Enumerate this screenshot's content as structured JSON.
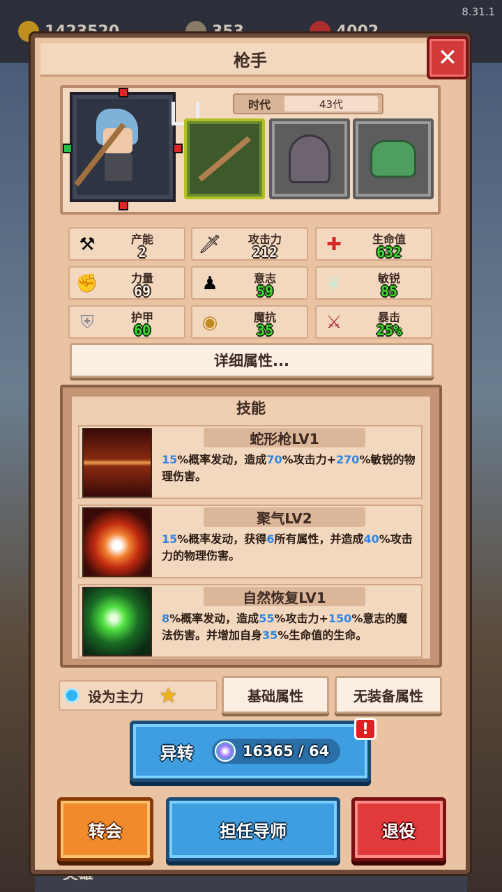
{
  "version": "8.31.1",
  "top_bar": {
    "gold": "1423520",
    "swords": "353",
    "gems": "4002"
  },
  "bottom_tab": "英雄",
  "panel": {
    "title": "枪手",
    "era_label": "时代",
    "era_value": "43代"
  },
  "stats": [
    {
      "name": "产能",
      "value": "2",
      "icon": "anvil-icon",
      "color": "white"
    },
    {
      "name": "攻击力",
      "value": "212",
      "icon": "sword-icon",
      "color": "white"
    },
    {
      "name": "生命值",
      "value": "632",
      "icon": "red-cross-icon",
      "color": "green"
    },
    {
      "name": "力量",
      "value": "69",
      "icon": "fist-icon",
      "color": "white"
    },
    {
      "name": "意志",
      "value": "59",
      "icon": "meditation-icon",
      "color": "green"
    },
    {
      "name": "敏锐",
      "value": "85",
      "icon": "wing-icon",
      "color": "green"
    },
    {
      "name": "护甲",
      "value": "60",
      "icon": "shield-icon",
      "color": "green"
    },
    {
      "name": "魔抗",
      "value": "35",
      "icon": "magic-resist-icon",
      "color": "green"
    },
    {
      "name": "暴击",
      "value": "25%",
      "icon": "crossed-swords-icon",
      "color": "green"
    }
  ],
  "detail_button": "详细属性...",
  "skills_title": "技能",
  "skills": [
    {
      "name": "蛇形枪LV1",
      "icon": "serpent-spear-icon",
      "desc": [
        {
          "t": "15",
          "n": true
        },
        {
          "t": "%概率发动，造成"
        },
        {
          "t": "70",
          "n": true
        },
        {
          "t": "%攻击力+"
        },
        {
          "t": "270",
          "n": true
        },
        {
          "t": "%敏锐的物理伤害。"
        }
      ]
    },
    {
      "name": "聚气LV2",
      "icon": "gather-qi-icon",
      "desc": [
        {
          "t": "15",
          "n": true
        },
        {
          "t": "%概率发动，获得"
        },
        {
          "t": "6",
          "n": true
        },
        {
          "t": "所有属性，并造成"
        },
        {
          "t": "40",
          "n": true
        },
        {
          "t": "%攻击力的物理伤害。"
        }
      ]
    },
    {
      "name": "自然恢复LV1",
      "icon": "natural-recovery-icon",
      "desc": [
        {
          "t": "8",
          "n": true
        },
        {
          "t": "%概率发动，造成"
        },
        {
          "t": "55",
          "n": true
        },
        {
          "t": "%攻击力+"
        },
        {
          "t": "150",
          "n": true
        },
        {
          "t": "%意志的魔法伤害。并增加自身"
        },
        {
          "t": "35",
          "n": true
        },
        {
          "t": "%生命值的生命。"
        }
      ]
    }
  ],
  "set_main_label": "设为主力",
  "base_attr_button": "基础属性",
  "no_equip_attr_button": "无装备属性",
  "transform_button": "异转",
  "transform_cost": "16365 / 64",
  "alert_mark": "!",
  "transfer_button": "转会",
  "mentor_button": "担任导师",
  "retire_button": "退役",
  "colors": {
    "panel_bg": "#e9c3a2",
    "number_blue": "#2f84e0",
    "value_green": "#3bdc2c",
    "button_blue": "#3f9ee0",
    "button_orange": "#f08a2a",
    "button_red": "#e23a3a"
  }
}
